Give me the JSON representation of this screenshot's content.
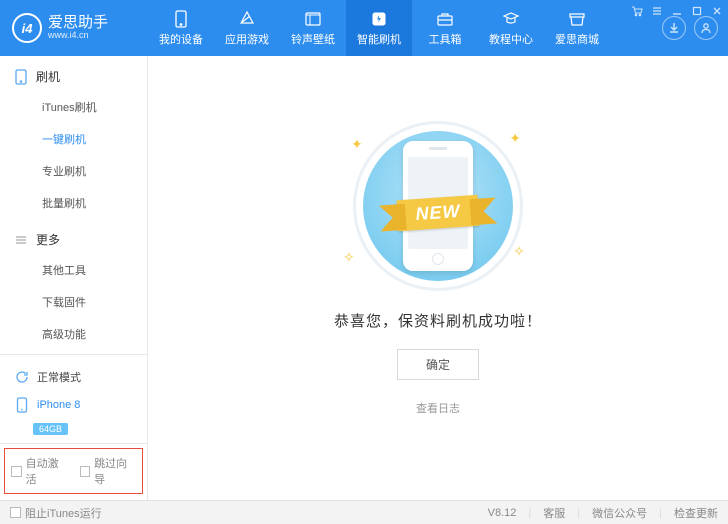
{
  "app": {
    "name": "爱思助手",
    "url": "www.i4.cn",
    "logo_text": "i4"
  },
  "nav": {
    "items": [
      {
        "icon": "phone",
        "label": "我的设备"
      },
      {
        "icon": "apps",
        "label": "应用游戏"
      },
      {
        "icon": "ring",
        "label": "铃声壁纸"
      },
      {
        "icon": "flash",
        "label": "智能刷机"
      },
      {
        "icon": "toolbox",
        "label": "工具箱"
      },
      {
        "icon": "tutorial",
        "label": "教程中心"
      },
      {
        "icon": "store",
        "label": "爱思商城"
      }
    ],
    "active_index": 3
  },
  "sidebar": {
    "groups": [
      {
        "title": "刷机",
        "items": [
          "iTunes刷机",
          "一键刷机",
          "专业刷机",
          "批量刷机"
        ],
        "active_index": 1
      },
      {
        "title": "更多",
        "items": [
          "其他工具",
          "下载固件",
          "高级功能"
        ],
        "active_index": -1
      }
    ],
    "mode": {
      "label": "正常模式"
    },
    "device": {
      "name": "iPhone 8",
      "storage": "64GB"
    },
    "checkboxes": {
      "auto_activate": "自动激活",
      "skip_guide": "跳过向导"
    }
  },
  "main": {
    "ribbon": "NEW",
    "success_message": "恭喜您，保资料刷机成功啦！",
    "ok_button": "确定",
    "log_link": "查看日志"
  },
  "statusbar": {
    "block_itunes": "阻止iTunes运行",
    "version": "V8.12",
    "support": "客服",
    "wechat": "微信公众号",
    "update": "检查更新"
  }
}
